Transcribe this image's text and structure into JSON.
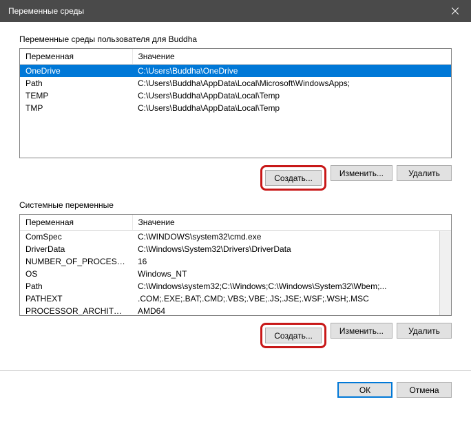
{
  "titlebar": {
    "title": "Переменные среды"
  },
  "userSection": {
    "label": "Переменные среды пользователя для Buddha",
    "headers": {
      "name": "Переменная",
      "value": "Значение"
    },
    "rows": [
      {
        "name": "OneDrive",
        "value": "C:\\Users\\Buddha\\OneDrive"
      },
      {
        "name": "Path",
        "value": "C:\\Users\\Buddha\\AppData\\Local\\Microsoft\\WindowsApps;"
      },
      {
        "name": "TEMP",
        "value": "C:\\Users\\Buddha\\AppData\\Local\\Temp"
      },
      {
        "name": "TMP",
        "value": "C:\\Users\\Buddha\\AppData\\Local\\Temp"
      }
    ],
    "buttons": {
      "create": "Создать...",
      "edit": "Изменить...",
      "delete": "Удалить"
    }
  },
  "systemSection": {
    "label": "Системные переменные",
    "headers": {
      "name": "Переменная",
      "value": "Значение"
    },
    "rows": [
      {
        "name": "ComSpec",
        "value": "C:\\WINDOWS\\system32\\cmd.exe"
      },
      {
        "name": "DriverData",
        "value": "C:\\Windows\\System32\\Drivers\\DriverData"
      },
      {
        "name": "NUMBER_OF_PROCESSORS",
        "value": "16"
      },
      {
        "name": "OS",
        "value": "Windows_NT"
      },
      {
        "name": "Path",
        "value": "C:\\Windows\\system32;C:\\Windows;C:\\Windows\\System32\\Wbem;..."
      },
      {
        "name": "PATHEXT",
        "value": ".COM;.EXE;.BAT;.CMD;.VBS;.VBE;.JS;.JSE;.WSF;.WSH;.MSC"
      },
      {
        "name": "PROCESSOR_ARCHITECTURE",
        "value": "AMD64"
      }
    ],
    "buttons": {
      "create": "Создать...",
      "edit": "Изменить...",
      "delete": "Удалить"
    }
  },
  "dialogButtons": {
    "ok": "ОК",
    "cancel": "Отмена"
  }
}
